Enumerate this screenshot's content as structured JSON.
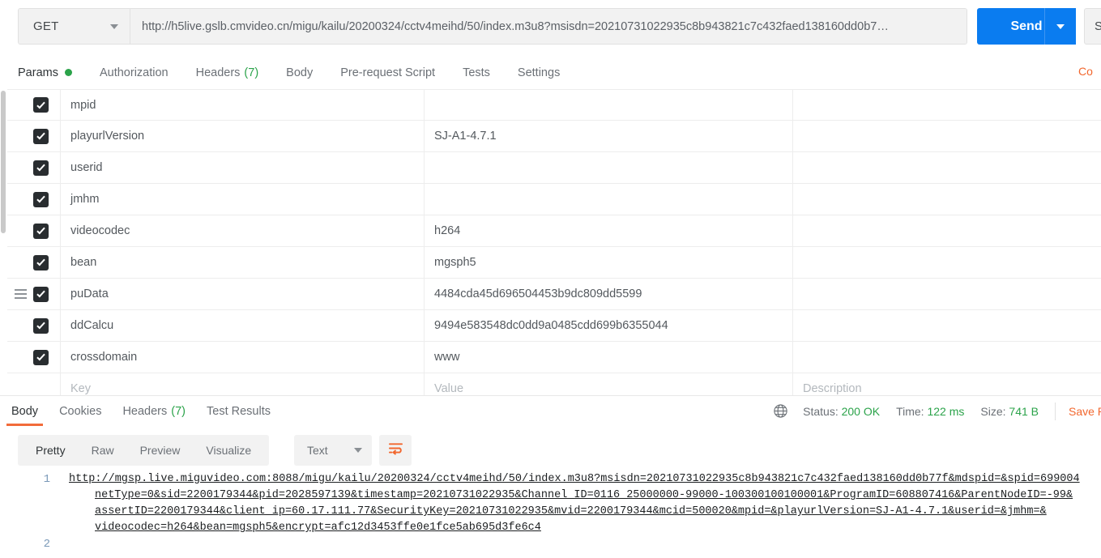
{
  "request": {
    "method": "GET",
    "method_icon": "chevron-down-icon",
    "url": "http://h5live.gslb.cmvideo.cn/migu/kailu/20200324/cctv4meihd/50/index.m3u8?msisdn=20210731022935c8b943821c7c432faed138160dd0b7…",
    "send_label": "Send",
    "save_label": "S",
    "cookies_label": "Co"
  },
  "request_tabs": [
    {
      "label": "Params",
      "badge": "",
      "dot": true,
      "active": true
    },
    {
      "label": "Authorization",
      "badge": "",
      "dot": false,
      "active": false
    },
    {
      "label": "Headers",
      "badge": "(7)",
      "dot": false,
      "active": false
    },
    {
      "label": "Body",
      "badge": "",
      "dot": false,
      "active": false
    },
    {
      "label": "Pre-request Script",
      "badge": "",
      "dot": false,
      "active": false
    },
    {
      "label": "Tests",
      "badge": "",
      "dot": false,
      "active": false
    },
    {
      "label": "Settings",
      "badge": "",
      "dot": false,
      "active": false
    }
  ],
  "params_table": {
    "columns": [
      "Key",
      "Value",
      "Description"
    ],
    "placeholder_row": {
      "key": "Key",
      "value": "Value",
      "description": "Description"
    },
    "rows": [
      {
        "checked": true,
        "handle": false,
        "key": "mpid",
        "value": "",
        "description": ""
      },
      {
        "checked": true,
        "handle": false,
        "key": "playurlVersion",
        "value": "SJ-A1-4.7.1",
        "description": ""
      },
      {
        "checked": true,
        "handle": false,
        "key": "userid",
        "value": "",
        "description": ""
      },
      {
        "checked": true,
        "handle": false,
        "key": "jmhm",
        "value": "",
        "description": ""
      },
      {
        "checked": true,
        "handle": false,
        "key": "videocodec",
        "value": "h264",
        "description": ""
      },
      {
        "checked": true,
        "handle": false,
        "key": "bean",
        "value": "mgsph5",
        "description": ""
      },
      {
        "checked": true,
        "handle": true,
        "key": "puData",
        "value": "4484cda45d696504453b9dc809dd5599",
        "description": ""
      },
      {
        "checked": true,
        "handle": false,
        "key": "ddCalcu",
        "value": "9494e583548dc0dd9a0485cdd699b6355044",
        "description": ""
      },
      {
        "checked": true,
        "handle": false,
        "key": "crossdomain",
        "value": "www",
        "description": ""
      }
    ]
  },
  "response": {
    "tabs": [
      {
        "label": "Body",
        "badge": "",
        "active": true
      },
      {
        "label": "Cookies",
        "badge": "",
        "active": false
      },
      {
        "label": "Headers",
        "badge": "(7)",
        "active": false
      },
      {
        "label": "Test Results",
        "badge": "",
        "active": false
      }
    ],
    "status": {
      "label": "Status:",
      "value": "200 OK"
    },
    "time": {
      "label": "Time:",
      "value": "122 ms"
    },
    "size": {
      "label": "Size:",
      "value": "741 B"
    },
    "save_response_label": "Save R",
    "globe_icon": "globe-icon",
    "view_modes": [
      {
        "label": "Pretty",
        "active": true
      },
      {
        "label": "Raw",
        "active": false
      },
      {
        "label": "Preview",
        "active": false
      },
      {
        "label": "Visualize",
        "active": false
      }
    ],
    "format": {
      "value": "Text",
      "icon": "chevron-down-icon"
    },
    "wrap_icon": "wrap-text-icon",
    "line_numbers": [
      "1",
      "",
      "",
      "",
      "2"
    ],
    "body_lines": [
      "http://mgsp.live.miguvideo.com:8088/migu/kailu/20200324/cctv4meihd/50/index.m3u8?msisdn=20210731022935c8b943821c7c432faed138160dd0b77f&mdspid=&spid=699004",
      "netType=0&sid=2200179344&pid=2028597139&timestamp=20210731022935&Channel_ID=0116_25000000-99000-100300100100001&ProgramID=608807416&ParentNodeID=-99&",
      "assertID=2200179344&client_ip=60.17.111.77&SecurityKey=20210731022935&mvid=2200179344&mcid=500020&mpid=&playurlVersion=SJ-A1-4.7.1&userid=&jmhm=&",
      "videocodec=h264&bean=mgsph5&encrypt=afc12d3453ffe0e1fce5ab695d3fe6c4"
    ]
  },
  "colors": {
    "accent_orange": "#f26b3a",
    "send_blue": "#0a7cf0",
    "status_green": "#2ba34a",
    "checkbox_dark": "#292d30",
    "text_primary": "#2f3437",
    "text_secondary": "#6b7076"
  }
}
